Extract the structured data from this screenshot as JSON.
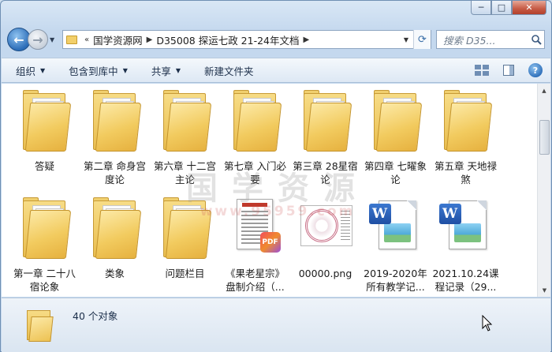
{
  "window": {
    "buttons": {
      "minimize": "─",
      "maximize": "□",
      "close": "✕"
    }
  },
  "navigation": {
    "back_icon": "←",
    "forward_icon": "→",
    "history_arrow": "▼"
  },
  "address_bar": {
    "overflow": "«",
    "segments": [
      "国学资源网",
      "D35008 探运七政 21-24年文档"
    ],
    "separator": "▶",
    "dropdown": "▼",
    "refresh_icon": "⟳"
  },
  "search": {
    "placeholder": "搜索 D35...",
    "icon": "magnifier-icon"
  },
  "toolbar": {
    "items": [
      {
        "label": "组织",
        "arrow": "▼"
      },
      {
        "label": "包含到库中",
        "arrow": "▼"
      },
      {
        "label": "共享",
        "arrow": "▼"
      },
      {
        "label": "新建文件夹",
        "arrow": ""
      }
    ],
    "help": "?"
  },
  "files": [
    {
      "name": "答疑",
      "type": "folder"
    },
    {
      "name": "第二章 命身宫度论",
      "type": "folder"
    },
    {
      "name": "第六章 十二宫主论",
      "type": "folder"
    },
    {
      "name": "第七章 入门必要",
      "type": "folder"
    },
    {
      "name": "第三章 28星宿论",
      "type": "folder"
    },
    {
      "name": "第四章 七曜象论",
      "type": "folder"
    },
    {
      "name": "第五章 天地禄煞",
      "type": "folder"
    },
    {
      "name": "第一章 二十八宿论象",
      "type": "folder"
    },
    {
      "name": "类象",
      "type": "folder"
    },
    {
      "name": "问题栏目",
      "type": "folder"
    },
    {
      "name": "《果老星宗》盘制介绍（...",
      "type": "pdf",
      "badge": "PDF"
    },
    {
      "name": "00000.png",
      "type": "png"
    },
    {
      "name": "2019-2020年所有教学记...",
      "type": "word",
      "badge": "W"
    },
    {
      "name": "2021.10.24课程记录（29...",
      "type": "word",
      "badge": "W"
    }
  ],
  "watermark": {
    "text": "国学资源",
    "url": "www.95959.com"
  },
  "status": {
    "count_text": "40 个对象"
  },
  "scrollbar": {
    "up": "▲",
    "down": "▼"
  }
}
